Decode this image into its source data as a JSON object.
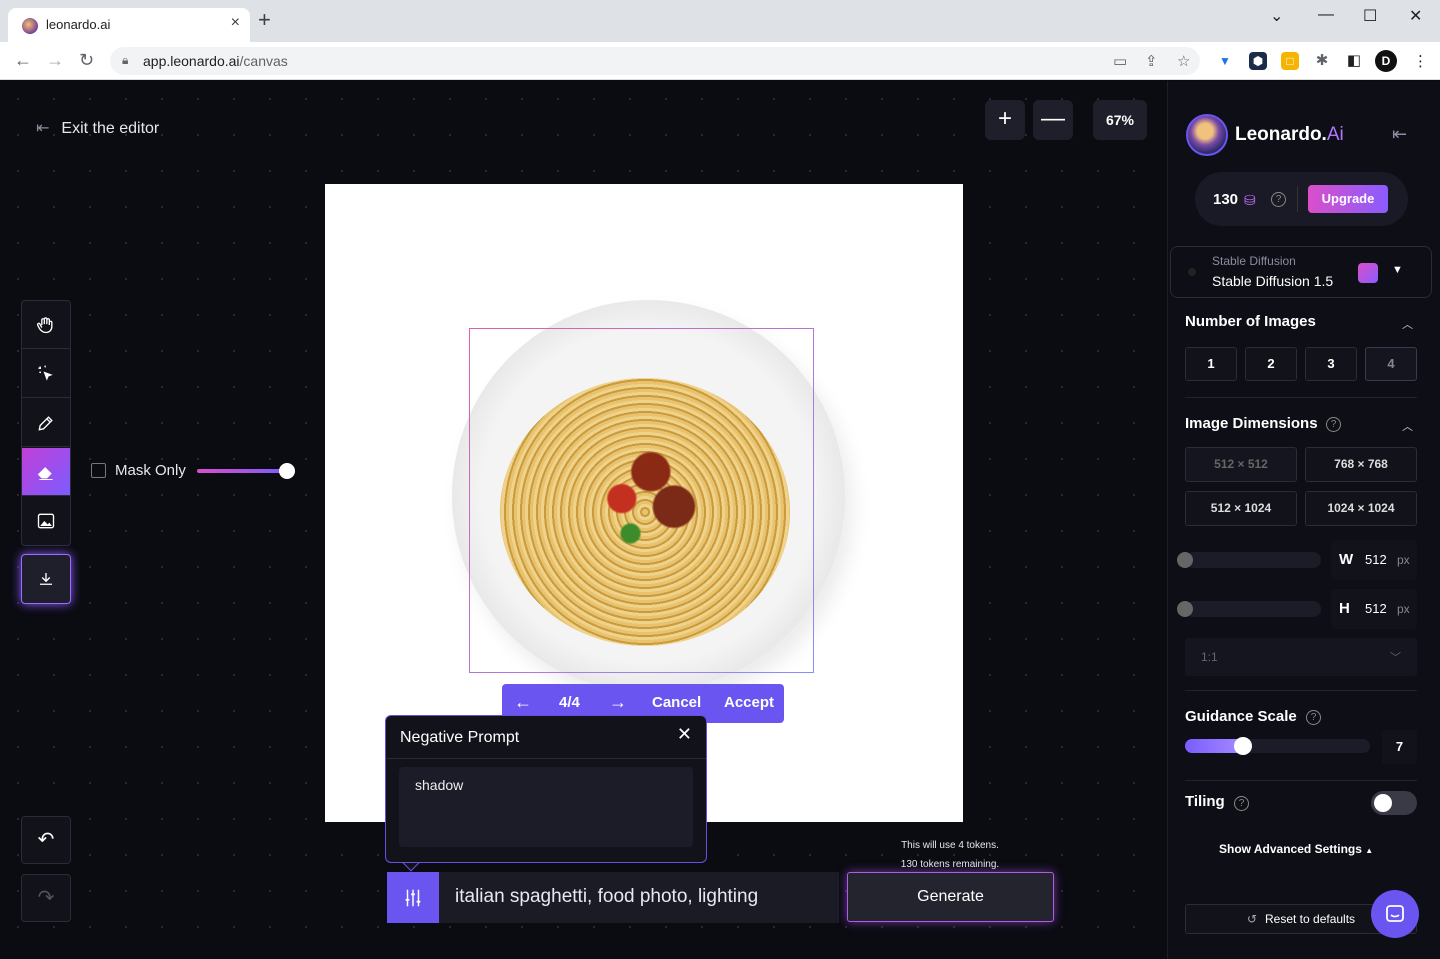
{
  "browser": {
    "tab_title": "leonardo.ai",
    "url_host": "app.leonardo.ai",
    "url_path": "/canvas",
    "profile_initial": "D"
  },
  "editor": {
    "exit_label": "Exit the editor",
    "zoom_in": "+",
    "zoom_out": "—",
    "zoom_level": "67%",
    "mask_only_label": "Mask Only",
    "mask_slider_value": 1.0
  },
  "generation_nav": {
    "counter": "4/4",
    "cancel_label": "Cancel",
    "accept_label": "Accept"
  },
  "negative_prompt": {
    "title": "Negative Prompt",
    "value": "shadow"
  },
  "prompt": {
    "value": "italian spaghetti, food photo, lighting",
    "token_note_1": "This will use 4 tokens.",
    "token_note_2": "130 tokens remaining.",
    "generate_label": "Generate"
  },
  "sidebar": {
    "brand_main": "Leonardo.",
    "brand_accent": "Ai",
    "token_count": "130",
    "upgrade_label": "Upgrade",
    "model_category": "Stable Diffusion",
    "model_name": "Stable Diffusion 1.5",
    "num_images_title": "Number of Images",
    "num_images_options": [
      "1",
      "2",
      "3",
      "4"
    ],
    "num_images_selected": "4",
    "image_dim_title": "Image Dimensions",
    "dims": [
      "512 × 512",
      "768 × 768",
      "512 × 1024",
      "1024 × 1024"
    ],
    "dim_selected": "512 × 512",
    "width_label": "W",
    "width_value": "512",
    "height_label": "H",
    "height_value": "512",
    "unit": "px",
    "aspect_ratio": "1:1",
    "guidance_title": "Guidance Scale",
    "guidance_value": "7",
    "tiling_title": "Tiling",
    "tiling_on": false,
    "advanced_label": "Show Advanced Settings",
    "reset_label": "Reset to defaults"
  },
  "colors": {
    "accent": "#6a55f0",
    "gradient_start": "#d94fc9",
    "gradient_end": "#8a5cff",
    "background": "#0b0b12"
  }
}
